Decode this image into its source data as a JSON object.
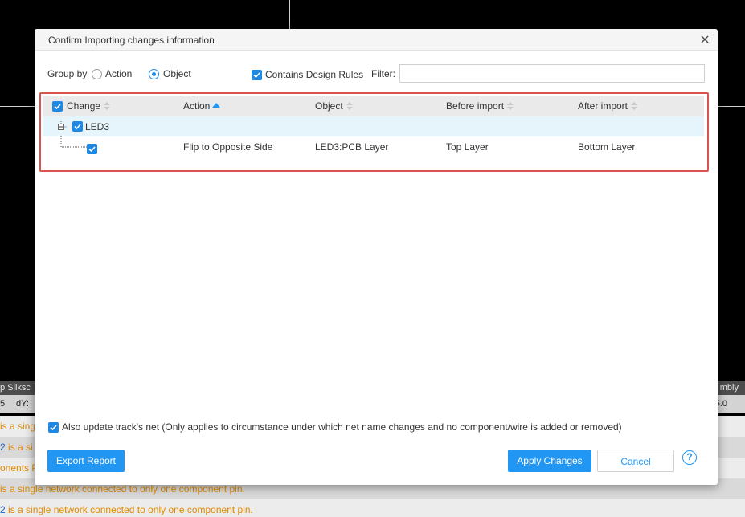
{
  "background": {
    "panel_head_left": "p Silksc",
    "panel_head_right": "mbly",
    "coord_left": "5",
    "coord_dy": "dY:",
    "coord_right": "5.0",
    "log_rows": [
      {
        "num": "",
        "text": " is a sing"
      },
      {
        "num": "2",
        "text": " is a si"
      },
      {
        "num": "",
        "text": "onents P"
      },
      {
        "num": "",
        "text": " is a single network connected to only one component pin."
      },
      {
        "num": "2",
        "text": " is a single network connected to only one component pin."
      }
    ]
  },
  "dialog": {
    "title": "Confirm Importing changes information",
    "group_by_label": "Group by",
    "group_options": [
      {
        "label": "Action",
        "checked": false
      },
      {
        "label": "Object",
        "checked": true
      }
    ],
    "contains_design_rules": {
      "label": "Contains Design Rules",
      "checked": true
    },
    "filter_label": "Filter:",
    "filter_value": "",
    "table": {
      "columns": [
        "Change",
        "Action",
        "Object",
        "Before import",
        "After import"
      ],
      "sorted_column": "Action",
      "groups": [
        {
          "name": "LED3",
          "checked": true,
          "expanded": true,
          "rows": [
            {
              "checked": true,
              "action": "Flip to Opposite Side",
              "object": "LED3:PCB Layer",
              "before": "Top Layer",
              "after": "Bottom Layer"
            }
          ]
        }
      ]
    },
    "update_track_net": {
      "checked": true,
      "label": "Also update track's net (Only applies to circumstance under which net name changes and no component/wire is added or removed)"
    },
    "buttons": {
      "export": "Export Report",
      "apply": "Apply Changes",
      "cancel": "Cancel",
      "help": "?"
    }
  },
  "colors": {
    "accent": "#2196f3",
    "highlight_border": "#d9534f",
    "warning_text": "#e08a00"
  }
}
